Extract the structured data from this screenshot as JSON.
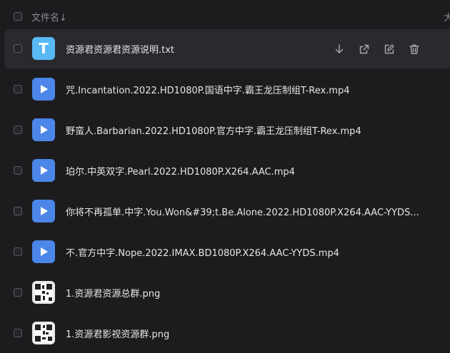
{
  "header": {
    "name_label": "文件名↓",
    "right_label": "大"
  },
  "files": [
    {
      "name": "资源君资源君资源说明.txt",
      "type": "txt",
      "icon_letter": "T"
    },
    {
      "name": "咒.Incantation.2022.HD1080P.国语中字.霸王龙压制组T-Rex.mp4",
      "type": "video"
    },
    {
      "name": "野蛮人.Barbarian.2022.HD1080P.官方中字.霸王龙压制组T-Rex.mp4",
      "type": "video"
    },
    {
      "name": "珀尔.中英双字.Pearl.2022.HD1080P.X264.AAC.mp4",
      "type": "video"
    },
    {
      "name": "你将不再孤单.中字.You.Won&#39;t.Be.Alone.2022.HD1080P.X264.AAC-YYDS...",
      "type": "video"
    },
    {
      "name": "不.官方中字.Nope.2022.IMAX.BD1080P.X264.AAC-YYDS.mp4",
      "type": "video"
    },
    {
      "name": "1.资源君资源总群.png",
      "type": "image"
    },
    {
      "name": "1.资源君影视资源群.png",
      "type": "image"
    }
  ],
  "row_actions": [
    "download-icon",
    "share-icon",
    "edit-icon",
    "delete-icon"
  ],
  "colors": {
    "background": "#1c1c1f",
    "hover_row": "#2a2a2e",
    "txt_icon": "#59b9f5",
    "video_icon": "#4b86e8"
  }
}
